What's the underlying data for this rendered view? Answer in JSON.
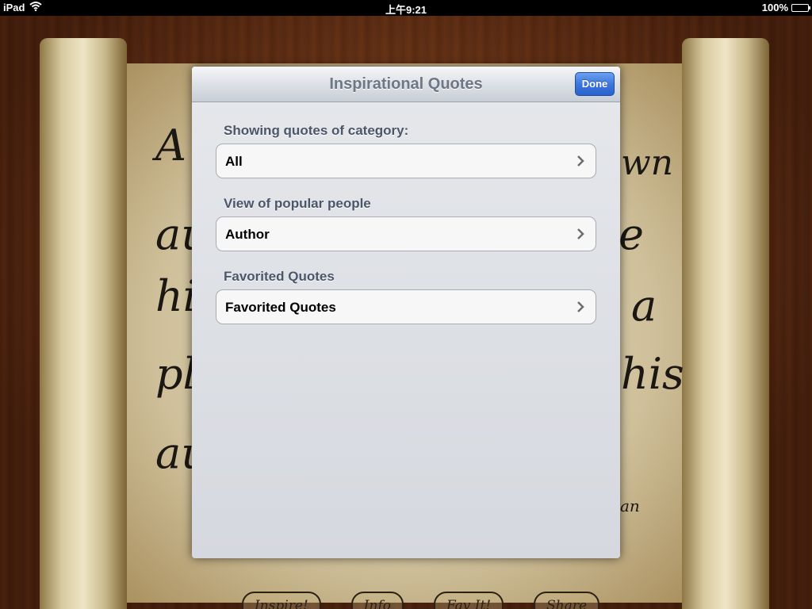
{
  "status_bar": {
    "device": "iPad",
    "time": "上午9:21",
    "battery": "100%"
  },
  "background": {
    "quote_fragments": [
      {
        "text": "A",
        "id": "frag-a"
      },
      {
        "text": "wn",
        "id": "frag-wn"
      },
      {
        "text": "au",
        "id": "frag-au1"
      },
      {
        "text": "e",
        "id": "frag-e"
      },
      {
        "text": "his",
        "id": "frag-his1"
      },
      {
        "text": "a",
        "id": "frag-a2"
      },
      {
        "text": "pla",
        "id": "frag-pla"
      },
      {
        "text": "his",
        "id": "frag-his2"
      },
      {
        "text": "au",
        "id": "frag-au2"
      },
      {
        "text": "an",
        "id": "frag-an"
      }
    ],
    "buttons": [
      "Inspire!",
      "Info",
      "Fav It!",
      "Share"
    ]
  },
  "modal": {
    "title": "Inspirational Quotes",
    "done_label": "Done",
    "sections": [
      {
        "header": "Showing quotes of category:",
        "cell": "All"
      },
      {
        "header": "View of popular people",
        "cell": "Author"
      },
      {
        "header": "Favorited Quotes",
        "cell": "Favorited Quotes"
      }
    ]
  }
}
